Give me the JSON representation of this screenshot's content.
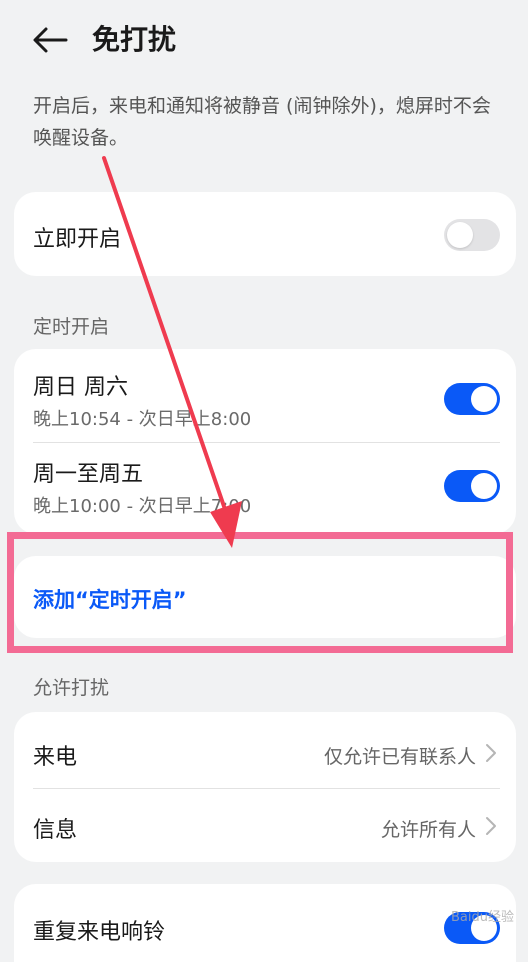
{
  "header": {
    "title": "免打扰"
  },
  "description": "开启后，来电和通知将被静音 (闹钟除外)，熄屏时不会唤醒设备。",
  "immediate": {
    "label": "立即开启",
    "enabled": false
  },
  "scheduled": {
    "section_label": "定时开启",
    "items": [
      {
        "title": "周日 周六",
        "time": "晚上10:54 - 次日早上8:00",
        "enabled": true
      },
      {
        "title": "周一至周五",
        "time": "晚上10:00 - 次日早上7:00",
        "enabled": true
      }
    ],
    "add_label": "添加“定时开启”"
  },
  "allow": {
    "section_label": "允许打扰",
    "items": [
      {
        "label": "来电",
        "value": "仅允许已有联系人"
      },
      {
        "label": "信息",
        "value": "允许所有人"
      }
    ]
  },
  "repeat_call": {
    "label": "重复来电响铃",
    "enabled": true
  },
  "watermark": "Baidu经验",
  "colors": {
    "accent": "#0a59f7",
    "highlight": "#f36b94",
    "arrow": "#ef3b4f",
    "background": "#f1f2f3"
  }
}
